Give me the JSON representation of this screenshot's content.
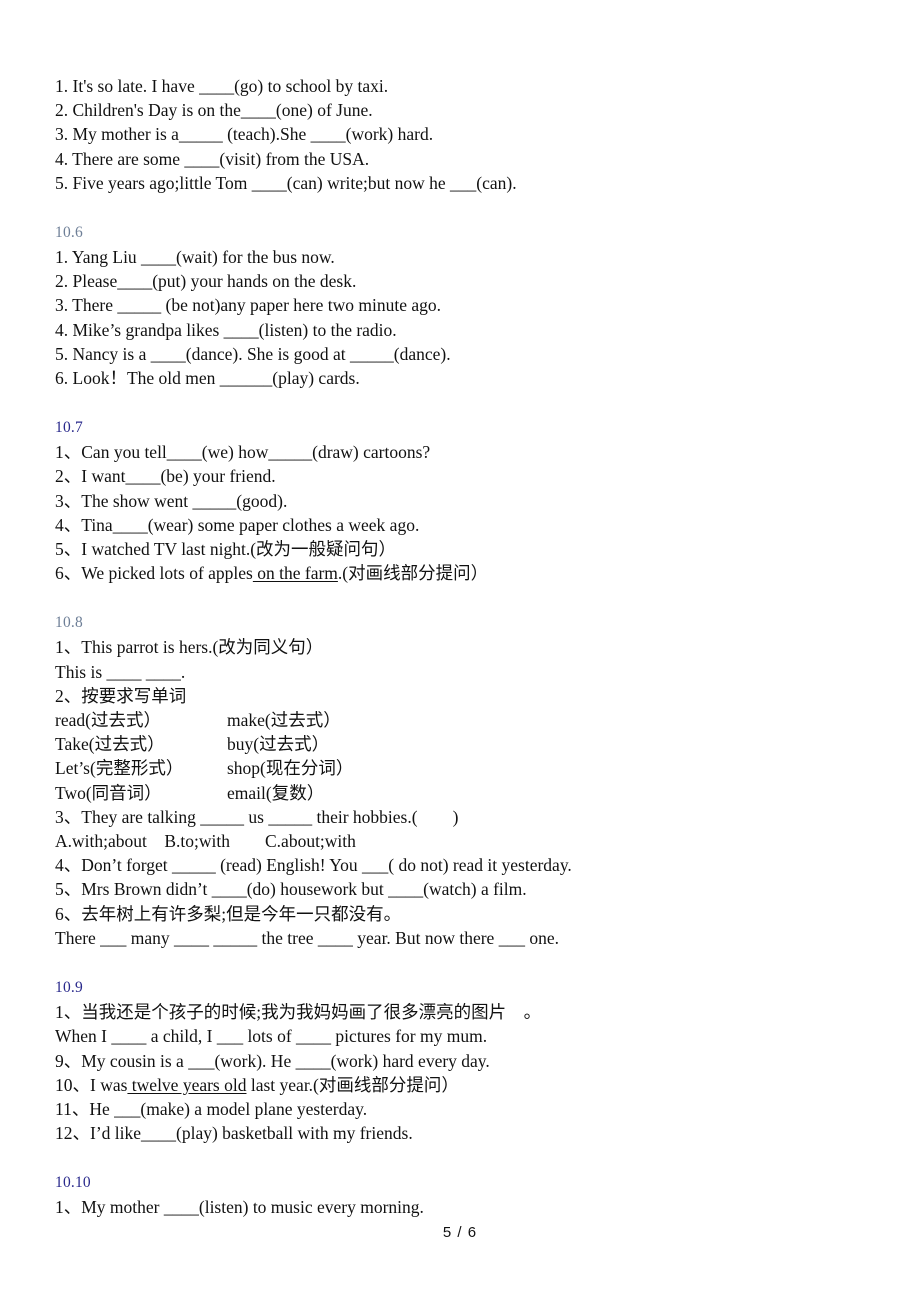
{
  "document": {
    "page_label": "5 / 6",
    "colors": {
      "heading_faded": "#6e7f97",
      "heading_navy": "#2a2a8c",
      "body_text": "#111111",
      "background": "#ffffff"
    }
  },
  "intro_exercises": {
    "lines": [
      "1. It's so late. I have ____(go) to school by taxi.",
      "2. Children's Day is on the____(one) of June.",
      "3. My mother is a_____ (teach).She ____(work) hard.",
      "4. There are some ____(visit) from the USA.",
      "5. Five years ago;little Tom ____(can) write;but now he ___(can)."
    ]
  },
  "sections": [
    {
      "heading": "10.6",
      "heading_style": "faded",
      "lines": [
        "1. Yang Liu ____(wait) for the bus now.",
        "2. Please____(put) your hands on the desk.",
        "3. There _____ (be not)any paper here two minute ago.",
        "4. Mike’s grandpa likes ____(listen) to the radio.",
        "5. Nancy is a ____(dance). She is good at _____(dance).",
        "6. Look！The old men ______(play) cards."
      ]
    },
    {
      "heading": "10.7",
      "heading_style": "navy",
      "lines": [
        "1、Can you tell____(we) how_____(draw) cartoons?",
        "2、I want____(be) your friend.",
        "3、The show went _____(good).",
        "4、Tina____(wear) some paper clothes a week ago.",
        "5、I watched TV last night.(改为一般疑问句）"
      ],
      "line6": {
        "before": "6、We picked lots of apples",
        "underlined": " on the farm",
        "after": ".(对画线部分提问）"
      }
    },
    {
      "heading": "10.8",
      "heading_style": "faded",
      "lines_before_vocab": [
        "1、This parrot is hers.(改为同义句）",
        "This is ____ ____.",
        "2、按要求写单词"
      ],
      "vocab_rows": [
        [
          "read(过去式）",
          "make(过去式）"
        ],
        [
          "Take(过去式）",
          "buy(过去式）"
        ],
        [
          "Let’s(完整形式）",
          "shop(现在分词）"
        ],
        [
          "Two(同音词）",
          "email(复数）"
        ]
      ],
      "lines_after_vocab": [
        "3、They are talking _____ us _____ their hobbies.(　　)",
        "A.with;about　B.to;with　　C.about;with",
        "4、Don’t forget _____ (read) English! You ___( do not) read it yesterday.",
        "5、Mrs Brown didn’t ____(do) housework but ____(watch) a film.",
        "6、去年树上有许多梨;但是今年一只都没有。",
        "There ___ many ____ _____ the tree ____ year. But now there ___ one."
      ]
    },
    {
      "heading": "10.9",
      "heading_style": "navy",
      "lines": [
        "1、当我还是个孩子的时候;我为我妈妈画了很多漂亮的图片　。",
        "When I ____ a child, I ___ lots of ____ pictures for my mum.",
        "9、My cousin is a ___(work). He ____(work) hard every day."
      ],
      "line10": {
        "before": "10、I was",
        "underlined": " twelve years old",
        "after": " last year.(对画线部分提问）"
      },
      "lines_tail": [
        "11、He ___(make) a model plane yesterday.",
        "12、I’d like____(play) basketball with my friends."
      ]
    },
    {
      "heading": "10.10",
      "heading_style": "navy",
      "lines": [
        "1、My mother ____(listen) to music every morning."
      ]
    }
  ]
}
